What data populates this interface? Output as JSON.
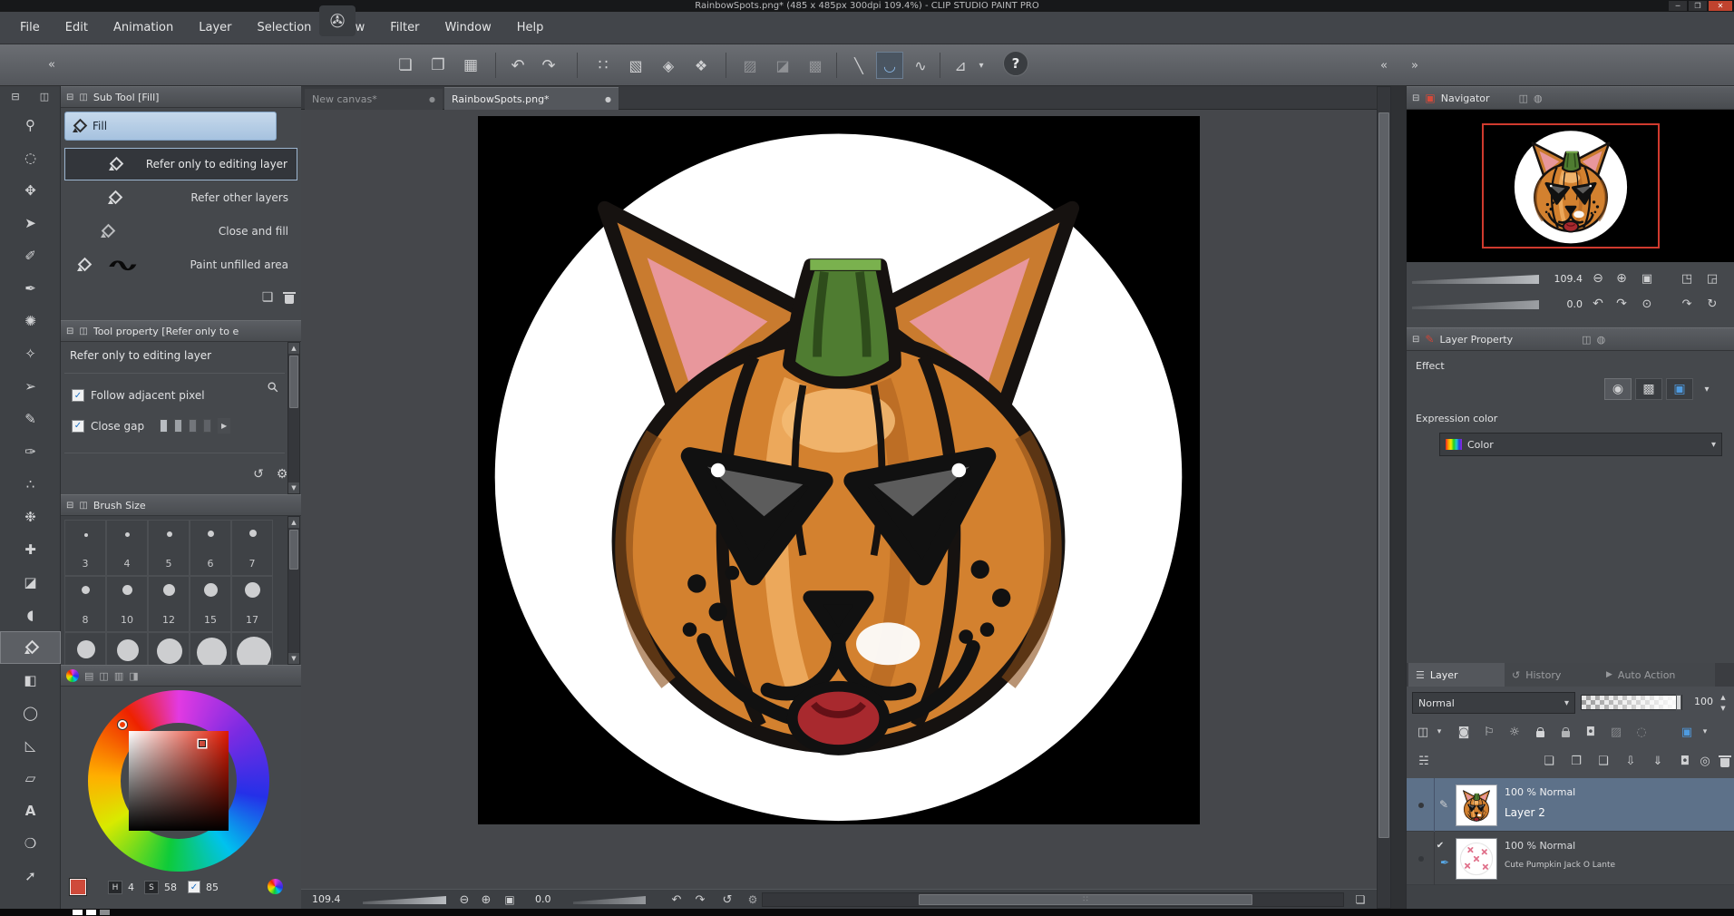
{
  "window": {
    "title": "RainbowSpots.png* (485 x 485px 300dpi 109.4%)  - CLIP STUDIO PAINT PRO"
  },
  "menu": {
    "items": [
      "File",
      "Edit",
      "Animation",
      "Layer",
      "Selection",
      "View",
      "Filter",
      "Window",
      "Help"
    ]
  },
  "toolbar": {
    "glyphs": [
      "✇",
      "❏",
      "❐",
      "▦",
      "↶",
      "↷",
      "∷",
      "▧",
      "◈",
      "❖",
      "▨",
      "◪",
      "▩",
      "╲",
      "◡",
      "∿",
      "⊿",
      "▾",
      "?"
    ]
  },
  "tools": {
    "items": [
      {
        "g": "⚲"
      },
      {
        "g": "◌"
      },
      {
        "g": "✥"
      },
      {
        "g": "➤"
      },
      {
        "g": "✐"
      },
      {
        "g": "✒"
      },
      {
        "g": "✺"
      },
      {
        "g": "✧"
      },
      {
        "g": "➢"
      },
      {
        "g": "✎"
      },
      {
        "g": "✑"
      },
      {
        "g": "∴"
      },
      {
        "g": "❉"
      },
      {
        "g": "✚"
      },
      {
        "g": "◪"
      },
      {
        "g": "◖"
      },
      {
        "g": ""
      },
      {
        "g": "◧"
      },
      {
        "g": "◯"
      },
      {
        "g": "◺"
      },
      {
        "g": "▱"
      },
      {
        "g": "A"
      },
      {
        "g": "❍"
      },
      {
        "g": "➚"
      }
    ]
  },
  "subtool": {
    "title": "Sub Tool [Fill]",
    "tool": "Fill",
    "rows": [
      "Refer only to editing layer",
      "Refer other layers",
      "Close and fill",
      "Paint unfilled area"
    ]
  },
  "toolprop": {
    "title": "Tool property [Refer only to e",
    "current": "Refer only to editing layer",
    "opt1": "Follow adjacent pixel",
    "opt2": "Close gap"
  },
  "brush": {
    "title": "Brush Size",
    "row1": [
      "3",
      "4",
      "5",
      "6",
      "7"
    ],
    "row2": [
      "8",
      "10",
      "12",
      "15",
      "17"
    ]
  },
  "colorpanel": {
    "h": "H",
    "h_val": "4",
    "s": "S",
    "s_val": "58",
    "v_val": "85"
  },
  "tabsbar": {
    "tab1": "New canvas*",
    "tab2": "RainbowSpots.png*"
  },
  "navigator": {
    "title": "Navigator",
    "zoom": "109.4",
    "rotation": "0.0"
  },
  "layerprop": {
    "title": "Layer Property",
    "effect": "Effect",
    "expression": "Expression color",
    "value": "Color"
  },
  "layerpanel": {
    "tab1": "Layer",
    "tab2": "History",
    "tab3": "Auto Action",
    "blend": "Normal",
    "opacity": "100",
    "rows": [
      {
        "meta": "100 % Normal",
        "name": "Layer 2"
      },
      {
        "meta": "100 % Normal",
        "name": "Cute Pumpkin Jack O Lante"
      }
    ]
  },
  "status": {
    "zoom": "109.4",
    "rotation": "0.0"
  },
  "glyphs": {
    "minimize": "─",
    "maximize": "❐",
    "close": "✕",
    "collapse_l": "«",
    "collapse_r": "»",
    "panel": "⊟",
    "panelgrid": "◫",
    "check": "✓",
    "check2": "✔",
    "dot": "●",
    "up": "▲",
    "down": "▼",
    "right": "▶",
    "smalldd": "▾",
    "mag": "⚲",
    "zoomout": "⊖",
    "zoomin": "⊕",
    "fit": "▣",
    "fliph": "◳",
    "flipv": "◲",
    "undo": "↶",
    "redo": "↷",
    "reset": "↺",
    "rotcw": "↻",
    "rotreset": "⊙",
    "gear": "⚙",
    "page": "❏",
    "folder": "❐",
    "paper": "❑",
    "transfer": "⇩",
    "merge": "⇓",
    "mask": "◘",
    "light": "◎",
    "stack": "☵",
    "rows": "☰",
    "clock": "↺",
    "pen": "✎",
    "nib": "✒",
    "scribble": "∿",
    "grip": "∷",
    "circle_fx": "◉",
    "tone": "▩",
    "bluebox": "▣",
    "wtab1": "▤",
    "wtab2": "◫",
    "wtab3": "▥",
    "wtab4": "◨",
    "clip": "◙",
    "flag": "⚐",
    "sun": "☼",
    "gray1": "▨",
    "gray2": "◌",
    "navtab": "◍",
    "redtab": "▣"
  }
}
